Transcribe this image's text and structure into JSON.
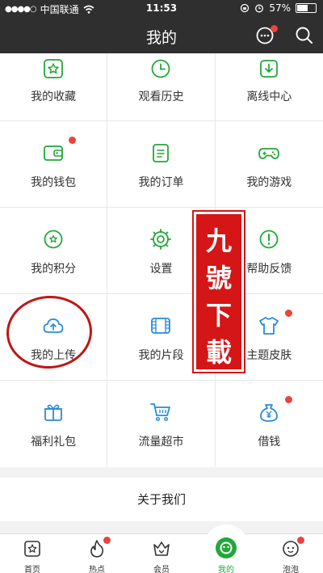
{
  "status": {
    "carrier": "中国联通",
    "time": "11:53",
    "battery": "57%",
    "battery_level": 0.57
  },
  "header": {
    "title": "我的"
  },
  "grid": {
    "rows": [
      [
        {
          "label": "我的收藏",
          "icon": "star-icon"
        },
        {
          "label": "观看历史",
          "icon": "history-icon"
        },
        {
          "label": "离线中心",
          "icon": "download-icon"
        }
      ],
      [
        {
          "label": "我的钱包",
          "icon": "wallet-icon",
          "badge": true
        },
        {
          "label": "我的订单",
          "icon": "order-icon"
        },
        {
          "label": "我的游戏",
          "icon": "gamepad-icon"
        }
      ],
      [
        {
          "label": "我的积分",
          "icon": "points-icon"
        },
        {
          "label": "设置",
          "icon": "gear-icon"
        },
        {
          "label": "帮助反馈",
          "icon": "help-icon"
        }
      ],
      [
        {
          "label": "我的上传",
          "icon": "cloud-upload-icon"
        },
        {
          "label": "我的片段",
          "icon": "clip-icon"
        },
        {
          "label": "主题皮肤",
          "icon": "shirt-icon",
          "badge": true
        }
      ],
      [
        {
          "label": "福利礼包",
          "icon": "gift-icon"
        },
        {
          "label": "流量超市",
          "icon": "cart-icon"
        },
        {
          "label": "借钱",
          "icon": "money-bag-icon",
          "badge": true
        }
      ]
    ]
  },
  "about": {
    "label": "关于我们"
  },
  "tabs": [
    {
      "label": "首页",
      "icon": "home-icon"
    },
    {
      "label": "热点",
      "icon": "flame-icon",
      "badge": true
    },
    {
      "label": "会员",
      "icon": "crown-icon"
    },
    {
      "label": "我的",
      "icon": "face-icon",
      "active": true
    },
    {
      "label": "泡泡",
      "icon": "bubble-face-icon",
      "badge": true
    }
  ],
  "seal": {
    "chars": [
      "九",
      "號",
      "下",
      "載"
    ]
  },
  "colors": {
    "green": "#22a83a",
    "blue": "#2a8bd8",
    "dark": "#2f2f2f",
    "red": "#d41616"
  }
}
